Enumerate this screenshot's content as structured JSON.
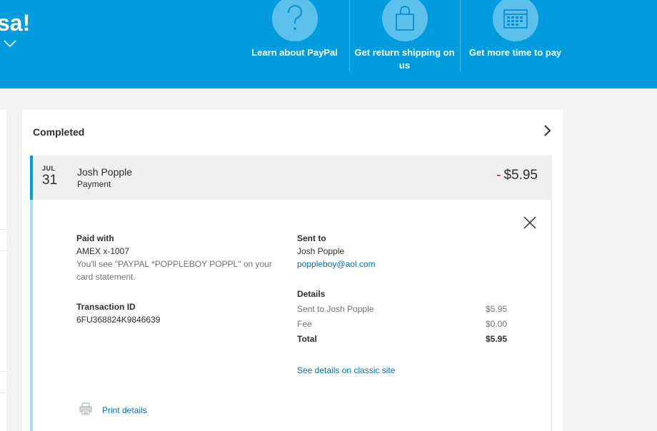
{
  "header": {
    "greeting": "sa!",
    "promos": [
      {
        "label": "Learn about PayPal",
        "icon": "question-icon"
      },
      {
        "label": "Get return shipping on us",
        "icon": "shopping-bag-icon"
      },
      {
        "label": "Get more time to pay",
        "icon": "calendar-icon"
      }
    ]
  },
  "activity": {
    "section_title": "Completed",
    "transaction": {
      "month": "JUL",
      "day": "31",
      "name": "Josh Popple",
      "type": "Payment",
      "sign": "-",
      "amount": "$5.95"
    },
    "details": {
      "paid_with_label": "Paid with",
      "card": "AMEX x-1007",
      "statement_note": "You'll see \"PAYPAL *POPPLEBOY POPPL\" on your card statement.",
      "transaction_id_label": "Transaction ID",
      "transaction_id": "6FU368824K9846639",
      "sent_to_label": "Sent to",
      "recipient_name": "Josh Popple",
      "recipient_email": "poppleboy@aol.com",
      "details_label": "Details",
      "lines": [
        {
          "label": "Sent to Josh Popple",
          "value": "$5.95"
        },
        {
          "label": "Fee",
          "value": "$0.00"
        }
      ],
      "total_label": "Total",
      "total_value": "$5.95",
      "classic_link": "See details on classic site",
      "print_link": "Print details"
    }
  },
  "colors": {
    "brand_blue": "#009cde",
    "link_blue": "#0070ba",
    "negative_red": "#d20000"
  }
}
